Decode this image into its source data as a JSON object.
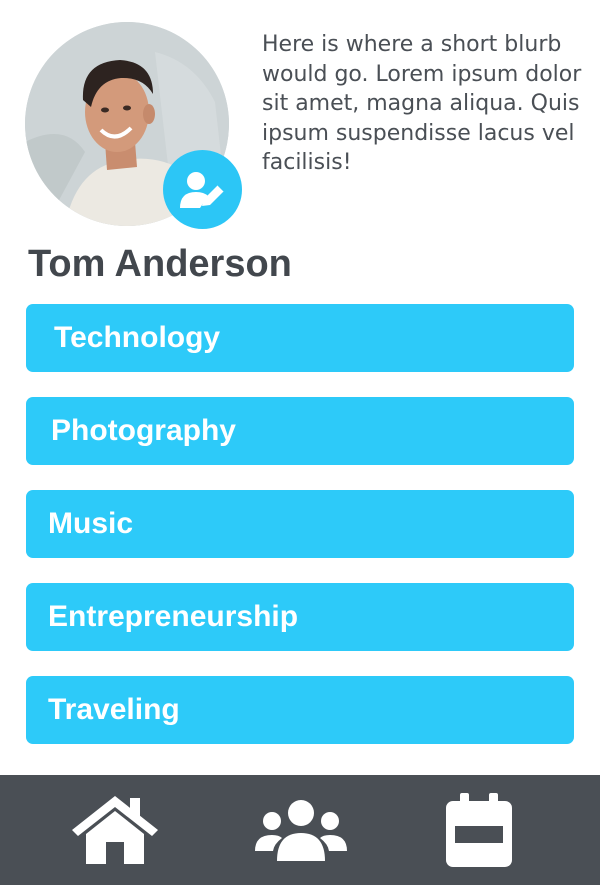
{
  "profile": {
    "name": "Tom Anderson",
    "blurb": "Here is where a short blurb would go. Lorem ipsum dolor sit amet, magna aliqua. Quis ipsum suspendisse lacus vel facilisis!",
    "avatar_icon": "profile-photo",
    "edit_icon": "user-edit-icon"
  },
  "interests": [
    {
      "label": "Technology"
    },
    {
      "label": "Photography"
    },
    {
      "label": "Music"
    },
    {
      "label": "Entrepreneurship"
    },
    {
      "label": "Traveling"
    }
  ],
  "nav": {
    "items": [
      {
        "icon": "home-icon"
      },
      {
        "icon": "users-icon"
      },
      {
        "icon": "calendar-icon"
      }
    ]
  },
  "colors": {
    "accent": "#2dcaf9",
    "nav_background": "#4a4f55",
    "text_dark": "#42474d",
    "text_body": "#4a4f55"
  }
}
